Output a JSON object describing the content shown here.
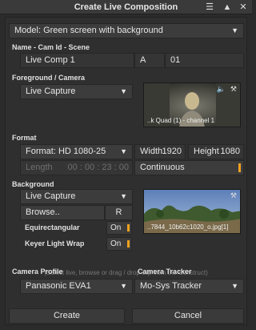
{
  "window": {
    "title": "Create Live Composition"
  },
  "model": {
    "value": "Model: Green screen with background"
  },
  "name_section": {
    "label": "Name - Cam Id - Scene",
    "name": "Live Comp 1",
    "cam_id": "A",
    "scene": "01"
  },
  "foreground": {
    "label": "Foreground / Camera",
    "source": "Live Capture",
    "thumb_caption": "..k Quad (1) - channel 1"
  },
  "format": {
    "label": "Format",
    "value": "Format: HD 1080-25",
    "width_label": "Width",
    "width_value": "1920",
    "height_label": "Height",
    "height_value": "1080",
    "length_label": "Length",
    "length_value": "00 : 00 : 23 : 00",
    "continuous_label": "Continuous"
  },
  "background": {
    "label": "Background",
    "source": "Live Capture",
    "browse_label": "Browse..",
    "r_label": "R",
    "equirect_label": "Equirectangular",
    "equirect_state": "On",
    "keyer_label": "Keyer Light Wrap",
    "keyer_state": "On",
    "thumb_caption": "..7844_10b62c1020_o.jpg[1]"
  },
  "hint": "(Select live, browse or drag / drop clip from the Construct)",
  "camera_profile": {
    "label": "Camera Profile",
    "value": "Panasonic EVA1"
  },
  "camera_tracker": {
    "label": "Camera Tracker",
    "value": "Mo-Sys Tracker"
  },
  "buttons": {
    "create": "Create",
    "cancel": "Cancel"
  },
  "icons": {
    "menu": "hamburger-icon",
    "collapse": "triangle-up-icon",
    "close": "close-icon",
    "dropdown": "caret-down-icon"
  },
  "colors": {
    "accent": "#f0a020"
  }
}
